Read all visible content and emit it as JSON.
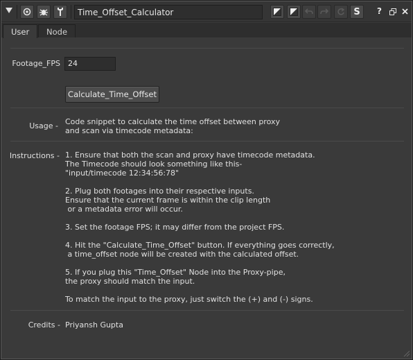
{
  "titlebar": {
    "node_name": "Time_Offset_Calculator",
    "help_glyph": "?",
    "icons": [
      "collapse-triangle-icon",
      "center-view-icon",
      "bug-icon",
      "wrench-icon",
      "color-swatch-icon",
      "color-swatch-2-icon",
      "undo-icon",
      "redo-icon",
      "revert-icon",
      "s-icon",
      "help-icon",
      "float-window-icon",
      "close-icon"
    ],
    "s_label": "S"
  },
  "tabs": [
    {
      "label": "User",
      "active": true
    },
    {
      "label": "Node",
      "active": false
    }
  ],
  "fields": {
    "fps_label": "Footage_FPS",
    "fps_value": "24",
    "button_label": "Calculate_Time_Offset",
    "usage_label": "Usage -",
    "usage_text": "Code snippet to calculate the time offset between proxy\nand scan via timecode metadata:",
    "instructions_label": "Instructions -",
    "instructions_text": "1. Ensure that both the scan and proxy have timecode metadata.\nThe Timecode should look something like this-\n\"input/timecode 12:34:56:78\"\n\n2. Plug both footages into their respective inputs.\nEnsure that the current frame is within the clip length\n or a metadata error will occur.\n\n3. Set the footage FPS; it may differ from the project FPS.\n\n4. Hit the \"Calculate_Time_Offset\" button. If everything goes correctly,\n a time_offset node will be created with the calculated offset.\n\n5. If you plug this \"Time_Offset\" Node into the Proxy-pipe,\nthe proxy should match the input.\n\nTo match the input to the proxy, just switch the (+) and (-) signs.",
    "credits_label": "Credits -",
    "credits_text": "Priyansh Gupta"
  }
}
